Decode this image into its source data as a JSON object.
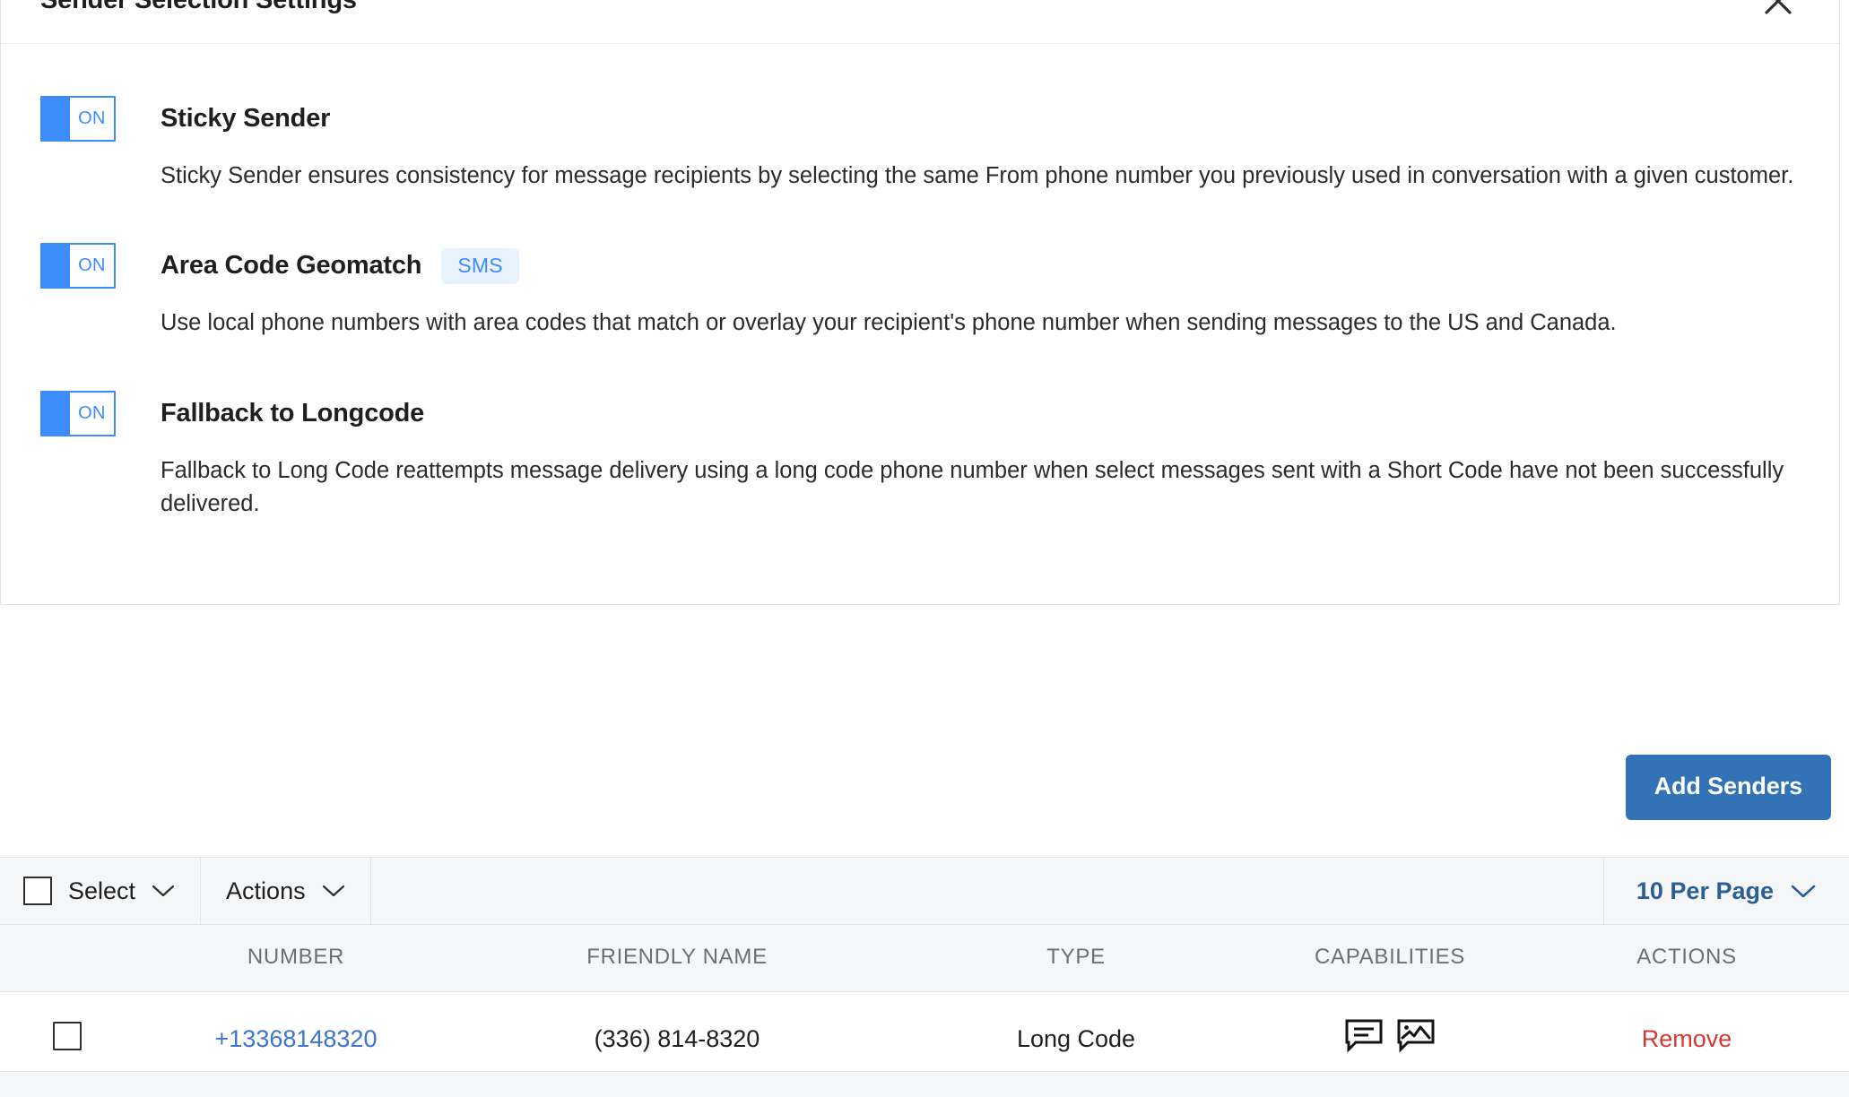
{
  "panel": {
    "title": "Sender Selection Settings",
    "close_icon": "close-icon"
  },
  "settings": [
    {
      "toggle_state": "ON",
      "title": "Sticky Sender",
      "badge": "",
      "description": "Sticky Sender ensures consistency for message recipients by selecting the same From phone number you previously used in conversation with a given customer."
    },
    {
      "toggle_state": "ON",
      "title": "Area Code Geomatch",
      "badge": "SMS",
      "description": "Use local phone numbers with area codes that match or overlay your recipient's phone number when sending messages to the US and Canada."
    },
    {
      "toggle_state": "ON",
      "title": "Fallback to Longcode",
      "badge": "",
      "description": "Fallback to Long Code reattempts message delivery using a long code phone number when select messages sent with a Short Code have not been successfully delivered."
    }
  ],
  "actions": {
    "add_senders_label": "Add Senders"
  },
  "toolbar": {
    "select_label": "Select",
    "actions_label": "Actions",
    "per_page_label": "10 Per Page"
  },
  "table": {
    "columns": [
      "NUMBER",
      "FRIENDLY NAME",
      "TYPE",
      "CAPABILITIES",
      "ACTIONS"
    ],
    "rows": [
      {
        "number": "+13368148320",
        "friendly_name": "(336) 814-8320",
        "type": "Long Code",
        "capabilities": [
          "sms-icon",
          "mms-icon"
        ],
        "action_label": "Remove"
      }
    ]
  },
  "colors": {
    "toggle_blue": "#3c8dfb",
    "badge_bg": "#e7f2fd",
    "primary_button": "#3273b6",
    "link_blue": "#3c74d0",
    "remove_red": "#cf3b33",
    "per_page_blue": "#2b5f96"
  }
}
